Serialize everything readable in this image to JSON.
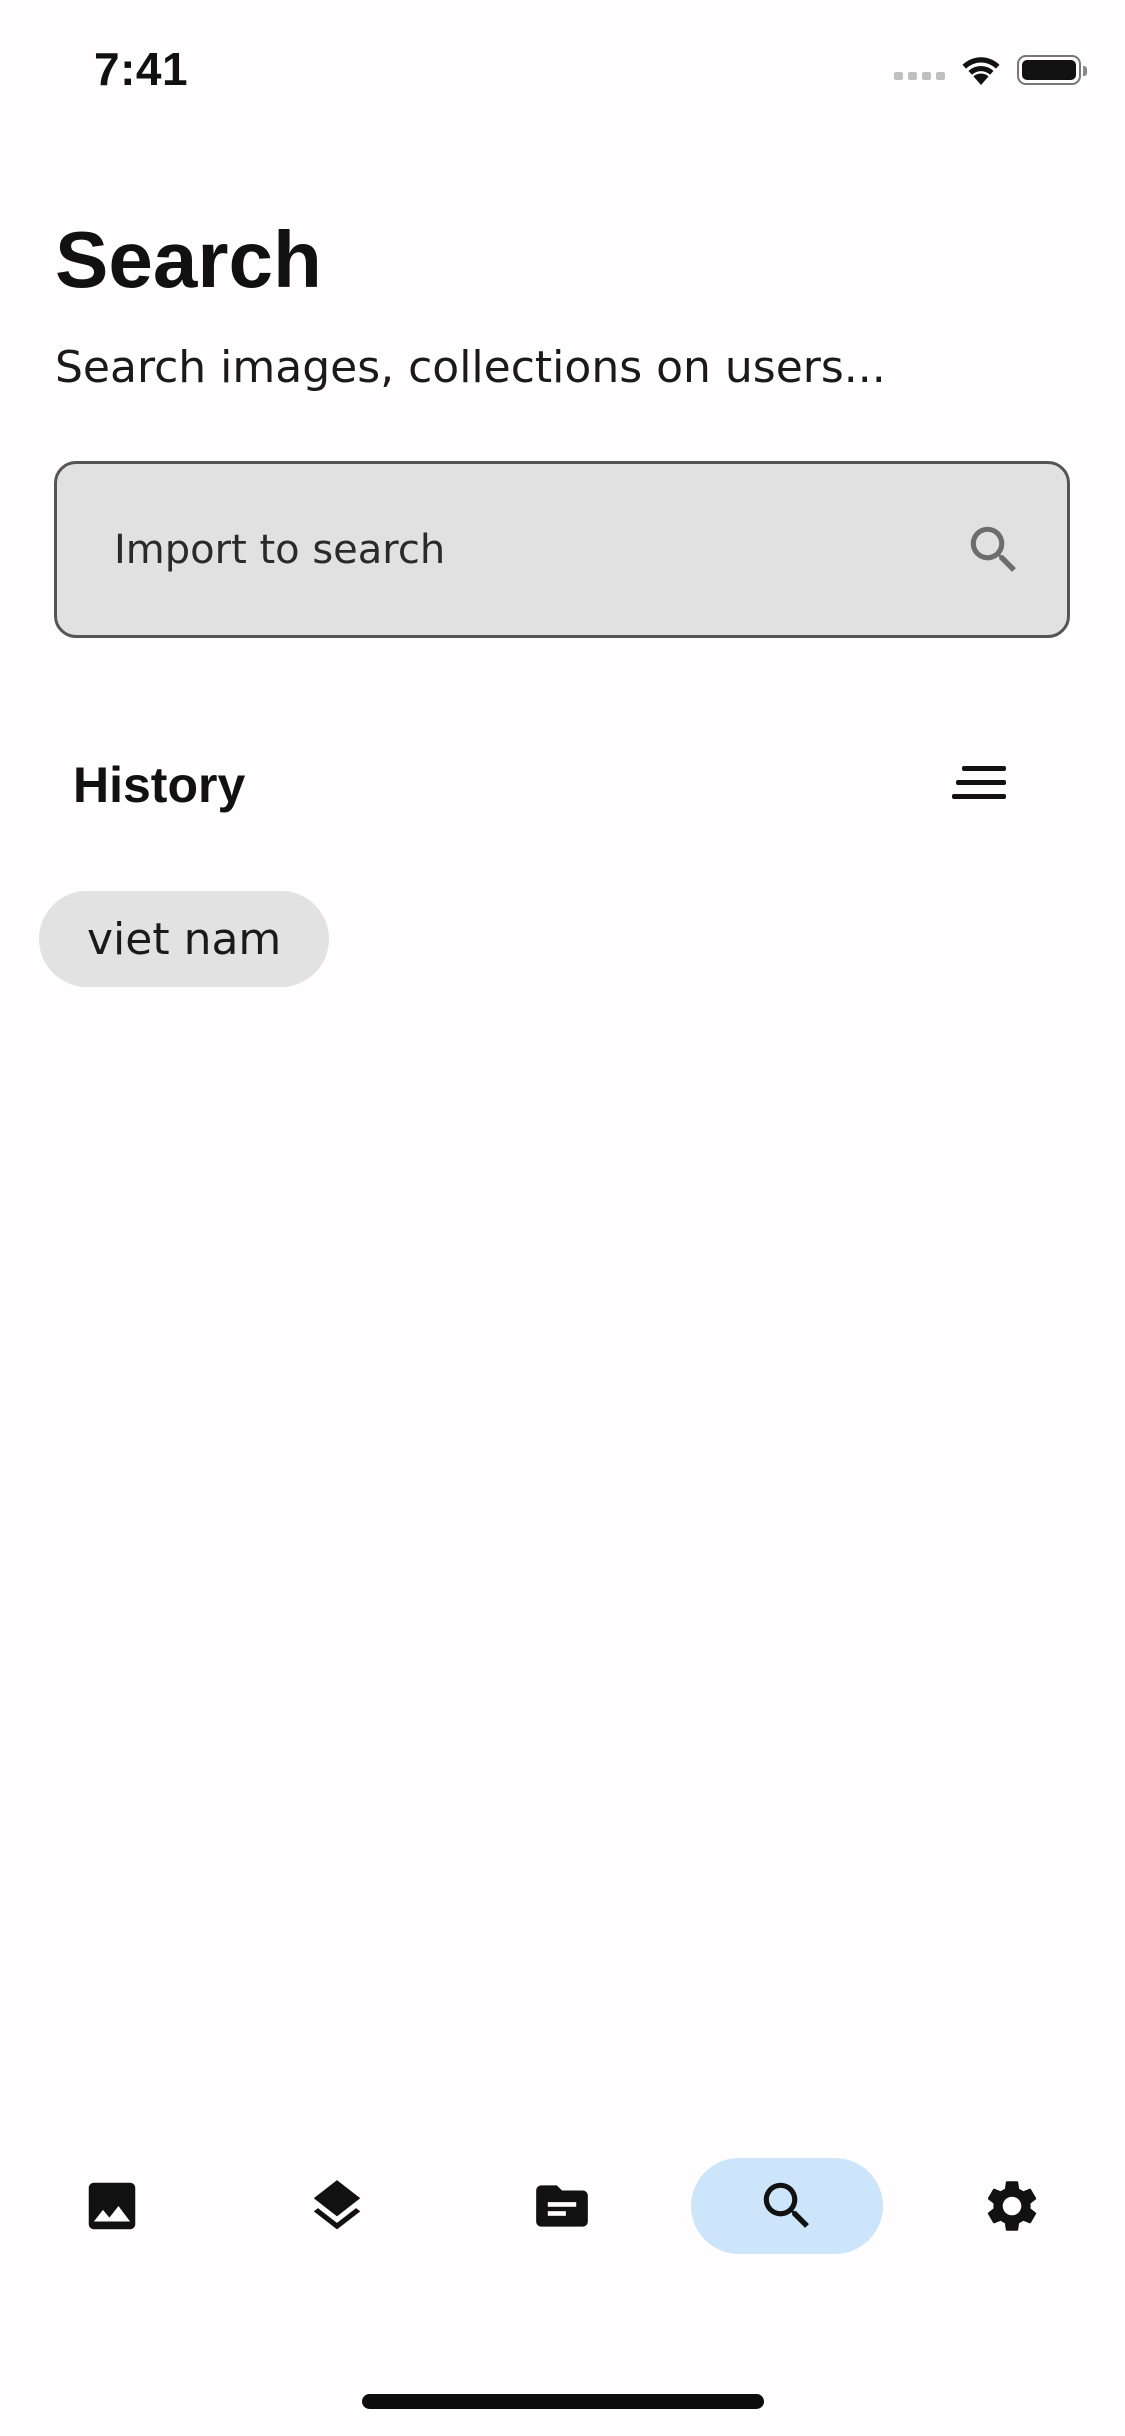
{
  "status_bar": {
    "time": "7:41",
    "icons": [
      "cellular-signal-icon",
      "wifi-icon",
      "battery-icon"
    ]
  },
  "header": {
    "title": "Search",
    "subtitle": "Search images, collections on users..."
  },
  "search": {
    "placeholder": "Import to search",
    "value": "",
    "icon": "search-icon"
  },
  "history": {
    "label": "History",
    "sort_icon": "sort-icon",
    "items": [
      "viet nam"
    ]
  },
  "bottom_nav": {
    "items": [
      {
        "icon": "image-icon",
        "active": false
      },
      {
        "icon": "layers-icon",
        "active": false
      },
      {
        "icon": "folder-icon",
        "active": false
      },
      {
        "icon": "search-icon",
        "active": true
      },
      {
        "icon": "settings-icon",
        "active": false
      }
    ],
    "active_color": "#cce5fb"
  },
  "colors": {
    "background": "#fffdfe",
    "search_field": "#e1e1e1",
    "chip": "#e2e2e2",
    "active_tab": "#cce5fb"
  }
}
